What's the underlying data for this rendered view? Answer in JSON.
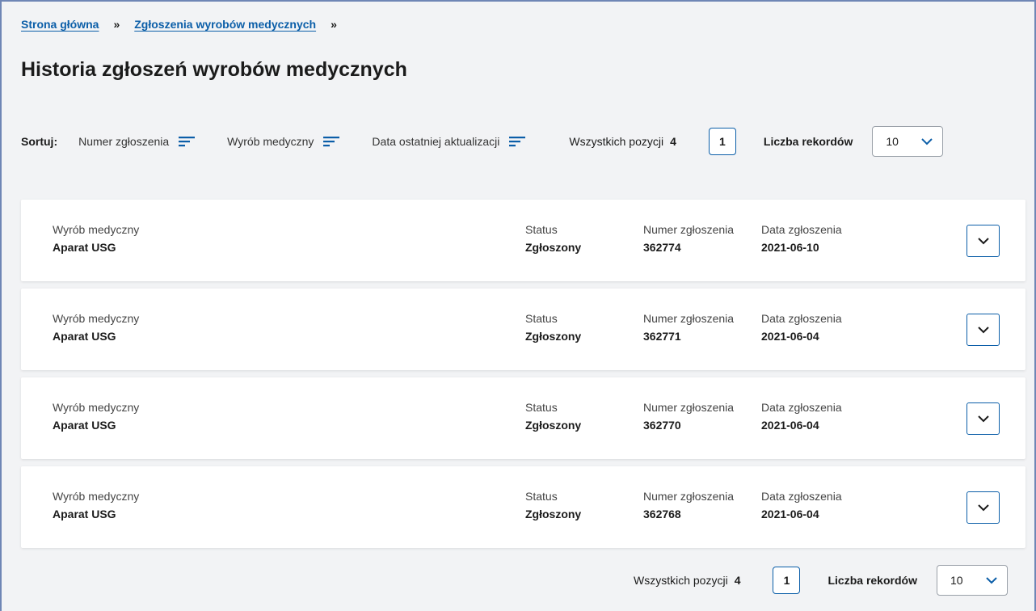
{
  "breadcrumb": {
    "home": "Strona główna",
    "section": "Zgłoszenia wyrobów medycznych",
    "separator": "»"
  },
  "page_title": "Historia zgłoszeń wyrobów medycznych",
  "sort": {
    "label": "Sortuj:",
    "options": [
      "Numer zgłoszenia",
      "Wyrób medyczny",
      "Data ostatniej aktualizacji"
    ],
    "icon": "sort-lines-icon"
  },
  "pagination": {
    "total_label": "Wszystkich pozycji",
    "total_value": "4",
    "current_page": "1",
    "records_label": "Liczba rekordów",
    "records_value": "10"
  },
  "card_labels": {
    "product": "Wyrób medyczny",
    "status": "Status",
    "number": "Numer zgłoszenia",
    "date": "Data zgłoszenia"
  },
  "items": [
    {
      "product": "Aparat USG",
      "status": "Zgłoszony",
      "number": "362774",
      "date": "2021-06-10"
    },
    {
      "product": "Aparat USG",
      "status": "Zgłoszony",
      "number": "362771",
      "date": "2021-06-04"
    },
    {
      "product": "Aparat USG",
      "status": "Zgłoszony",
      "number": "362770",
      "date": "2021-06-04"
    },
    {
      "product": "Aparat USG",
      "status": "Zgłoszony",
      "number": "362768",
      "date": "2021-06-04"
    }
  ],
  "colors": {
    "accent": "#0b5ea8",
    "background": "#f2f3f5",
    "card": "#ffffff",
    "frame": "#6f86b5"
  }
}
